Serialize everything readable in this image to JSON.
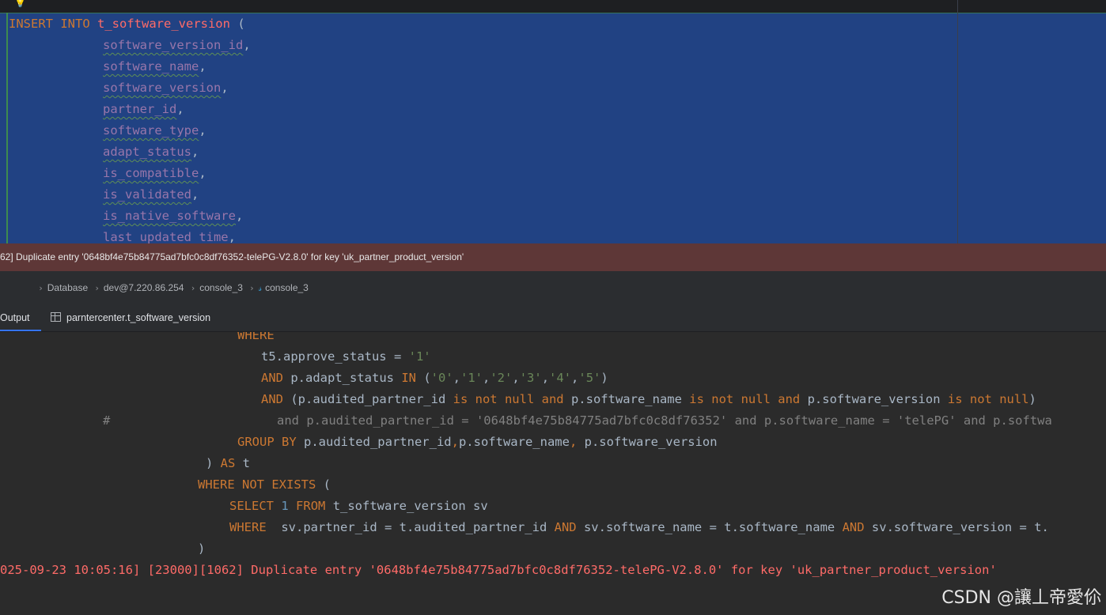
{
  "editor": {
    "lines": [
      [
        "INSERT INTO",
        "t_software_version",
        " ("
      ],
      [
        "software_version_id",
        ","
      ],
      [
        "software_name",
        ","
      ],
      [
        "software_version",
        ","
      ],
      [
        "partner_id",
        ","
      ],
      [
        "software_type",
        ","
      ],
      [
        "adapt_status",
        ","
      ],
      [
        "is_compatible",
        ","
      ],
      [
        "is_validated",
        ","
      ],
      [
        "is_native_software",
        ","
      ],
      [
        "last_updated_time",
        ","
      ]
    ]
  },
  "error_banner": "62] Duplicate entry '0648bf4e75b84775ad7bfc0c8df76352-telePG-V2.8.0' for key 'uk_partner_product_version'",
  "breadcrumb": [
    "Database",
    "dev@7.220.86.254",
    "console_3",
    "console_3"
  ],
  "tabs": [
    "Output",
    "parntercenter.t_software_version"
  ],
  "output": {
    "l1": "WHERE",
    "l2": [
      "t5.approve_status = ",
      "'1'"
    ],
    "l3": [
      "AND",
      " p.adapt_status ",
      "IN",
      " (",
      "'0'",
      ",",
      "'1'",
      ",",
      "'2'",
      ",",
      "'3'",
      ",",
      "'4'",
      ",",
      "'5'",
      ")"
    ],
    "l4": [
      "AND",
      " (p.audited_partner_id ",
      "is not null and",
      " p.software_name ",
      "is not null and",
      " p.software_version ",
      "is not null",
      ")"
    ],
    "l5": [
      "#",
      "and p.audited_partner_id = '0648bf4e75b84775ad7bfc0c8df76352' and p.software_name = 'telePG' and p.softwa"
    ],
    "l6": [
      "GROUP BY",
      " p.audited_partner_id",
      ",",
      "p.software_name",
      ",",
      " p.software_version"
    ],
    "l7": [
      ") ",
      "AS",
      " t"
    ],
    "l8": [
      "WHERE NOT EXISTS",
      " ("
    ],
    "l9": [
      "SELECT",
      " ",
      "1",
      " ",
      "FROM",
      " t_software_version sv"
    ],
    "l10": [
      "WHERE",
      "  sv.partner_id = t.audited_partner_id ",
      "AND",
      " sv.software_name = t.software_name ",
      "AND",
      " sv.software_version = t."
    ],
    "l11": ")",
    "l12": "025-09-23 10:05:16] [23000][1062] Duplicate entry '0648bf4e75b84775ad7bfc0c8df76352-telePG-V2.8.0' for key 'uk_partner_product_version'"
  },
  "watermark": "CSDN @讓丄帝愛伱"
}
